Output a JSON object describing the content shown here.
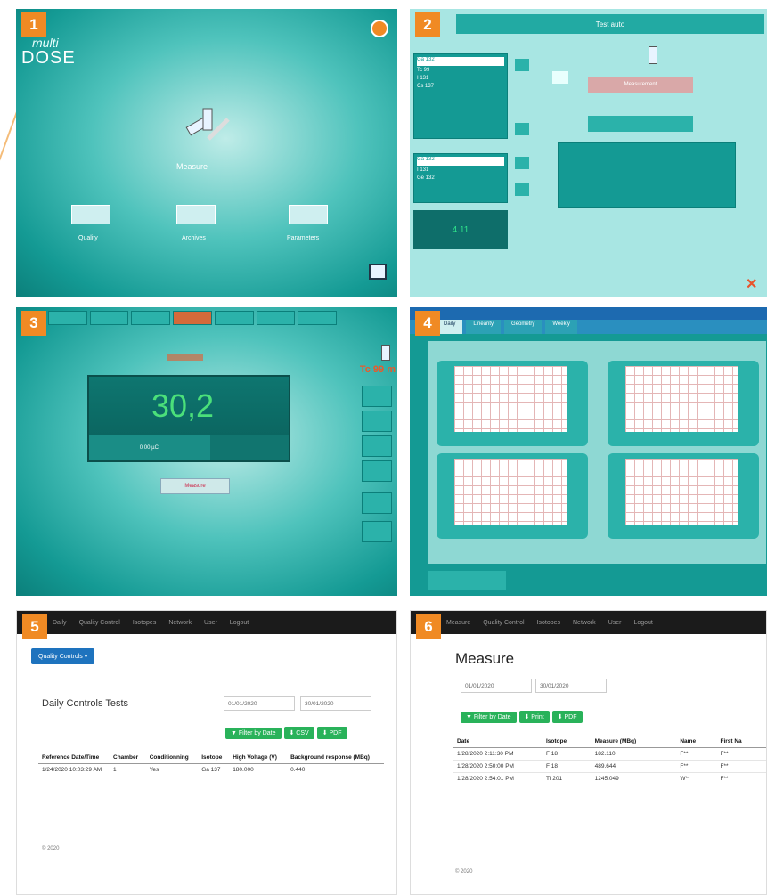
{
  "badges": [
    "1",
    "2",
    "3",
    "4",
    "5",
    "6"
  ],
  "p1": {
    "brand_small": "multi",
    "brand": "DOSE",
    "measure": "Measure",
    "items": [
      "Quality",
      "Archives",
      "Parameters"
    ]
  },
  "p2": {
    "header": "Test auto",
    "list1": [
      "Ga 132",
      "Tc 99",
      "I 131",
      "Cs 137"
    ],
    "list2": [
      "Ga 132",
      "I 131",
      "Ge 132"
    ],
    "center_btn": "Measurement",
    "value": "4.11"
  },
  "p3": {
    "isotope_label": "Tc 99 m",
    "reading": "30,2",
    "unit_left": "0 00 µCi",
    "action": "Measure"
  },
  "p4": {
    "tabs": [
      "Daily",
      "Linearity",
      "Geometry",
      "Weekly"
    ]
  },
  "p5": {
    "nav": [
      "Daily",
      "Quality Control",
      "Isotopes",
      "Network",
      "User",
      "Logout"
    ],
    "dropdown": "Quality Controls ▾",
    "title": "Daily Controls Tests",
    "date_from": "01/01/2020",
    "date_to": "30/01/2020",
    "buttons": [
      "▼ Filter by Date",
      "⬇ CSV",
      "⬇ PDF"
    ],
    "headers": [
      "Reference Date/Time",
      "Chamber",
      "Conditionning",
      "Isotope",
      "High Voltage (V)",
      "Background response (MBq)"
    ],
    "row": [
      "1/24/2020 10:03:29 AM",
      "1",
      "Yes",
      "Ga 137",
      "180.000",
      "0.440"
    ],
    "footer": "© 2020"
  },
  "p6": {
    "nav": [
      "Measure",
      "Quality Control",
      "Isotopes",
      "Network",
      "User",
      "Logout"
    ],
    "title": "Measure",
    "date_from": "01/01/2020",
    "date_to": "30/01/2020",
    "buttons": [
      "▼ Filter by Date",
      "⬇ Print",
      "⬇ PDF"
    ],
    "headers": [
      "Date",
      "Isotope",
      "Measure (MBq)",
      "Name",
      "First Na"
    ],
    "rows": [
      [
        "1/28/2020 2:11:30 PM",
        "F 18",
        "182.110",
        "F**",
        "F**"
      ],
      [
        "1/28/2020 2:50:00 PM",
        "F 18",
        "489.644",
        "F**",
        "F**"
      ],
      [
        "1/28/2020 2:54:01 PM",
        "Tl 201",
        "1245.049",
        "W**",
        "F**"
      ]
    ],
    "footer": "© 2020"
  },
  "colors": {
    "accent": "#f08a24",
    "teal": "#149a94",
    "green": "#29b25a",
    "nav": "#1b1b1b"
  }
}
